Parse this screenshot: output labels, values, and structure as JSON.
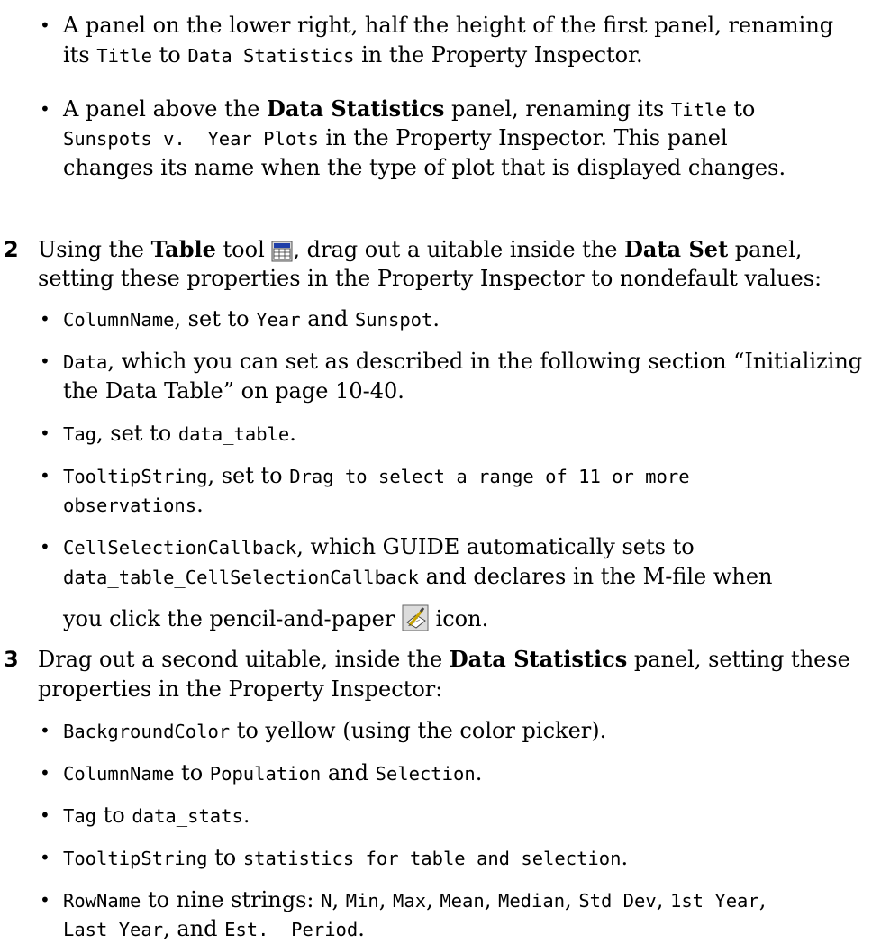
{
  "items": [
    {
      "kind": "b1",
      "p": [
        "A panel on the lower right, half the height of the first panel, renaming"
      ]
    },
    {
      "kind": "b1c",
      "p": [
        "its ",
        {
          "m": "Title"
        },
        " to ",
        {
          "m": "Data Statistics"
        },
        " in the Property Inspector."
      ]
    },
    {
      "kind": "b2",
      "p": [
        "A panel above the ",
        {
          "b": "Data Statistics"
        },
        " panel, renaming its ",
        {
          "m": "Title"
        },
        " to"
      ]
    },
    {
      "kind": "b2c",
      "p": [
        {
          "m": "Sunspots v.  Year Plots"
        },
        " in the Property Inspector. This panel"
      ]
    },
    {
      "kind": "b2c2",
      "p": [
        "changes its name when the type of plot that is displayed changes."
      ]
    },
    {
      "kind": "s2",
      "p": [
        "Using the ",
        {
          "b": "Table"
        },
        " tool ",
        {
          "icon": "table-tool-icon"
        },
        ", drag out a uitable inside the ",
        {
          "b": "Data Set"
        },
        " panel,"
      ]
    },
    {
      "kind": "s2c",
      "p": [
        "setting these properties in the Property Inspector to nondefault values:"
      ]
    },
    {
      "kind": "b3",
      "p": [
        {
          "m": "ColumnName"
        },
        ", set to ",
        {
          "m": "Year"
        },
        " and ",
        {
          "m": "Sunspot"
        },
        "."
      ]
    },
    {
      "kind": "b4",
      "p": [
        {
          "m": "Data"
        },
        ", which you can set as described in the following section “Initializing"
      ]
    },
    {
      "kind": "b4c",
      "p": [
        "the Data Table” on page 10-40."
      ]
    },
    {
      "kind": "b5",
      "p": [
        {
          "m": "Tag"
        },
        ", set to ",
        {
          "m": "data_table"
        },
        "."
      ]
    },
    {
      "kind": "b6",
      "p": [
        {
          "m": "TooltipString"
        },
        ", set to ",
        {
          "m": "Drag to select a range of 11 or more"
        }
      ]
    },
    {
      "kind": "b6c",
      "p": [
        {
          "m": "observations"
        },
        "."
      ]
    },
    {
      "kind": "b7",
      "p": [
        {
          "m": "CellSelectionCallback"
        },
        ", which GUIDE automatically sets to"
      ]
    },
    {
      "kind": "b7c",
      "p": [
        {
          "m": "data_table_CellSelectionCallback"
        },
        " and declares in the M-file when"
      ]
    },
    {
      "kind": "b7c2",
      "p": [
        "you click the pencil-and-paper ",
        {
          "icon": "pencil-paper-icon"
        },
        " icon."
      ]
    },
    {
      "kind": "s3",
      "p": [
        "Drag out a second uitable, inside the ",
        {
          "b": "Data Statistics"
        },
        " panel, setting these"
      ]
    },
    {
      "kind": "s3c",
      "p": [
        "properties in the Property Inspector:"
      ]
    },
    {
      "kind": "b8",
      "p": [
        {
          "m": "BackgroundColor"
        },
        " to yellow (using the color picker)."
      ]
    },
    {
      "kind": "b9",
      "p": [
        {
          "m": "ColumnName"
        },
        " to ",
        {
          "m": "Population"
        },
        " and ",
        {
          "m": "Selection"
        },
        "."
      ]
    },
    {
      "kind": "b10",
      "p": [
        {
          "m": "Tag"
        },
        " to ",
        {
          "m": "data_stats"
        },
        "."
      ]
    },
    {
      "kind": "b11",
      "p": [
        {
          "m": "TooltipString"
        },
        " to ",
        {
          "m": "statistics for table and selection"
        },
        "."
      ]
    },
    {
      "kind": "b12",
      "p": [
        {
          "m": "RowName"
        },
        " to nine strings: ",
        {
          "m": "N"
        },
        ", ",
        {
          "m": "Min"
        },
        ", ",
        {
          "m": "Max"
        },
        ", ",
        {
          "m": "Mean"
        },
        ", ",
        {
          "m": "Median"
        },
        ", ",
        {
          "m": "Std Dev"
        },
        ", ",
        {
          "m": "1st Year"
        },
        ","
      ]
    },
    {
      "kind": "b12c",
      "p": [
        {
          "m": "Last Year"
        },
        ", and ",
        {
          "m": "Est.  Period"
        },
        "."
      ]
    }
  ],
  "steps": {
    "s2": "2",
    "s3": "3"
  },
  "bullet_char": "•"
}
